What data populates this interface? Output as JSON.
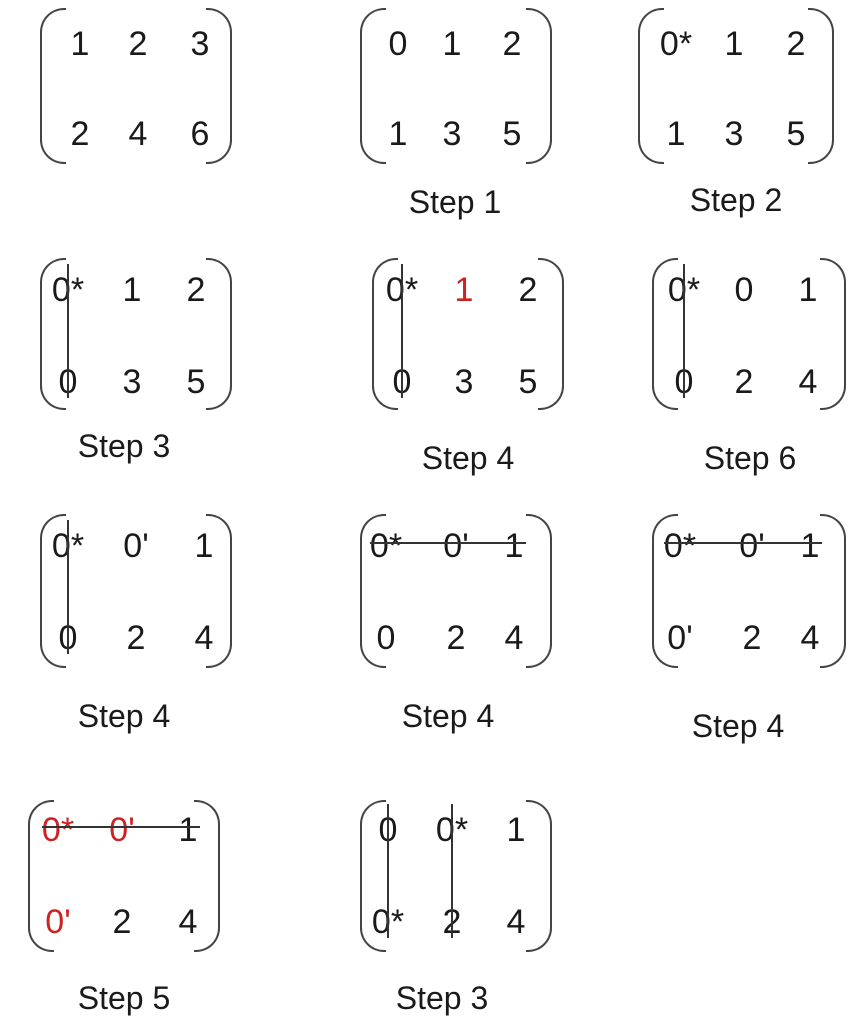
{
  "colors": {
    "ink": "#1a1a1a",
    "highlight": "#cc2222"
  },
  "matrices": [
    {
      "cells": [
        [
          "1",
          "2",
          "3"
        ],
        [
          "2",
          "4",
          "6"
        ]
      ],
      "caption": "",
      "highlight": [],
      "covered_columns": [],
      "covered_rows": []
    },
    {
      "cells": [
        [
          "0",
          "1",
          "2"
        ],
        [
          "1",
          "3",
          "5"
        ]
      ],
      "caption": "Step 1",
      "highlight": [],
      "covered_columns": [],
      "covered_rows": []
    },
    {
      "cells": [
        [
          "0*",
          "1",
          "2"
        ],
        [
          "1",
          "3",
          "5"
        ]
      ],
      "caption": "Step 2",
      "highlight": [],
      "covered_columns": [],
      "covered_rows": []
    },
    {
      "cells": [
        [
          "0*",
          "1",
          "2"
        ],
        [
          "0",
          "3",
          "5"
        ]
      ],
      "caption": "Step 3",
      "highlight": [],
      "covered_columns": [
        0
      ],
      "covered_rows": []
    },
    {
      "cells": [
        [
          "0*",
          "1",
          "2"
        ],
        [
          "0",
          "3",
          "5"
        ]
      ],
      "caption": "Step 4",
      "highlight": [
        [
          0,
          1
        ]
      ],
      "covered_columns": [
        0
      ],
      "covered_rows": []
    },
    {
      "cells": [
        [
          "0*",
          "0",
          "1"
        ],
        [
          "0",
          "2",
          "4"
        ]
      ],
      "caption": "Step 6",
      "highlight": [],
      "covered_columns": [
        0
      ],
      "covered_rows": []
    },
    {
      "cells": [
        [
          "0*",
          "0'",
          "1"
        ],
        [
          "0",
          "2",
          "4"
        ]
      ],
      "caption": "Step 4",
      "highlight": [],
      "covered_columns": [
        0
      ],
      "covered_rows": []
    },
    {
      "cells": [
        [
          "0*",
          "0'",
          "1"
        ],
        [
          "0",
          "2",
          "4"
        ]
      ],
      "caption": "Step 4",
      "highlight": [],
      "covered_columns": [],
      "covered_rows": [
        0
      ]
    },
    {
      "cells": [
        [
          "0*",
          "0'",
          "1"
        ],
        [
          "0'",
          "2",
          "4"
        ]
      ],
      "caption": "Step 4",
      "highlight": [],
      "covered_columns": [],
      "covered_rows": [
        0
      ]
    },
    {
      "cells": [
        [
          "0*",
          "0'",
          "1"
        ],
        [
          "0'",
          "2",
          "4"
        ]
      ],
      "caption": "Step 5",
      "highlight": [
        [
          0,
          0
        ],
        [
          0,
          1
        ],
        [
          1,
          0
        ]
      ],
      "covered_columns": [],
      "covered_rows": [
        0
      ]
    },
    {
      "cells": [
        [
          "0",
          "0*",
          "1"
        ],
        [
          "0*",
          "2",
          "4"
        ]
      ],
      "caption": "Step 3",
      "highlight": [],
      "covered_columns": [
        0,
        1
      ],
      "covered_rows": []
    }
  ]
}
